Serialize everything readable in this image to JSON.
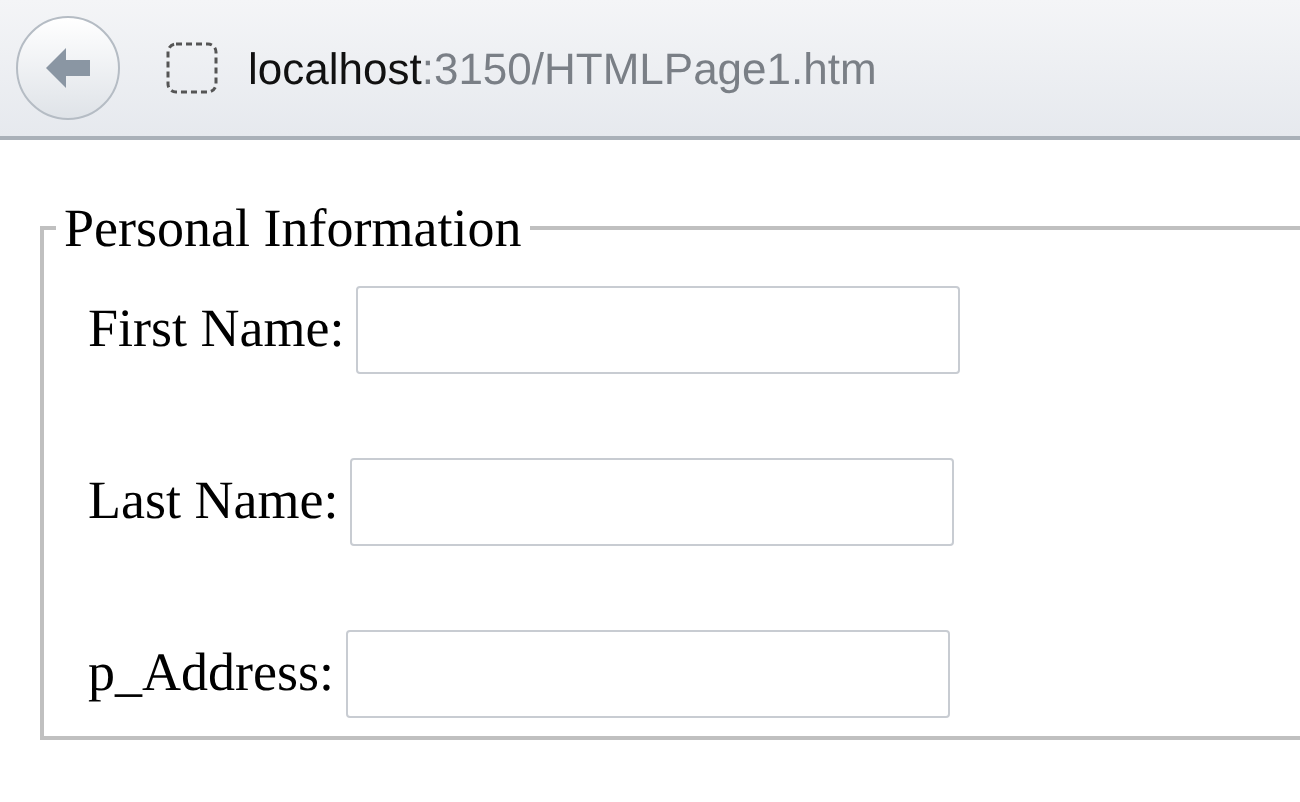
{
  "address_bar": {
    "host": "localhost",
    "path": ":3150/HTMLPage1.htm"
  },
  "form": {
    "legend": "Personal Information",
    "fields": [
      {
        "label": "First Name:"
      },
      {
        "label": "Last Name:"
      },
      {
        "label": "p_Address:"
      }
    ]
  }
}
